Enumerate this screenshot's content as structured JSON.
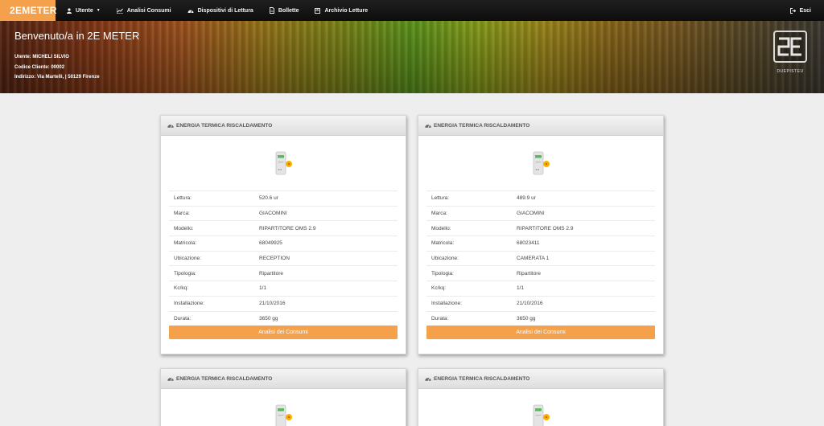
{
  "navbar": {
    "brand": "2EMETER",
    "items": [
      {
        "label": "Utente",
        "icon": "user-icon",
        "caret": "▼"
      },
      {
        "label": "Analisi Consumi",
        "icon": "chart-icon"
      },
      {
        "label": "Dispositivi di Lettura",
        "icon": "dashboard-icon"
      },
      {
        "label": "Bollette",
        "icon": "document-icon"
      },
      {
        "label": "Archivio Letture",
        "icon": "archive-icon"
      }
    ],
    "logout": "Esci",
    "logout_icon": "logout-icon",
    "accent": "#f5a04a"
  },
  "banner": {
    "title": "Benvenuto/a in 2E METER",
    "utente": "Utente: MICHELI SILVIO",
    "codice": "Codice Cliente: 00002",
    "indirizzo": "Indirizzo: Via Martelli, | 50129 Firenze",
    "logo_caption": "DUEPISTEU"
  },
  "card_labels": {
    "lettura": "Lettura:",
    "marca": "Marca:",
    "modello": "Modello:",
    "matricola": "Matricola:",
    "ubicazione": "Ubicazione:",
    "tipologia": "Tipologia:",
    "kc": "Kc/kq:",
    "installazione": "Installazione:",
    "durata": "Durata:",
    "button": "Analisi dei Consumi"
  },
  "cards": [
    {
      "header": "ENERGIA TERMICA RISCALDAMENTO",
      "lettura": "520.6 ur",
      "marca": "GIACOMINI",
      "modello": "RIPARTITORE OMS 2.9",
      "matricola": "68049925",
      "ubicazione": "RECEPTION",
      "tipologia": "Ripartitore",
      "kc": "1/1",
      "installazione": "21/10/2016",
      "durata": "3650 gg"
    },
    {
      "header": "ENERGIA TERMICA RISCALDAMENTO",
      "lettura": "489.9 ur",
      "marca": "GIACOMINI",
      "modello": "RIPARTITORE OMS 2.9",
      "matricola": "68023411",
      "ubicazione": "CAMERATA 1",
      "tipologia": "Ripartitore",
      "kc": "1/1",
      "installazione": "21/10/2016",
      "durata": "3650 gg"
    },
    {
      "header": "ENERGIA TERMICA RISCALDAMENTO"
    },
    {
      "header": "ENERGIA TERMICA RISCALDAMENTO"
    }
  ]
}
